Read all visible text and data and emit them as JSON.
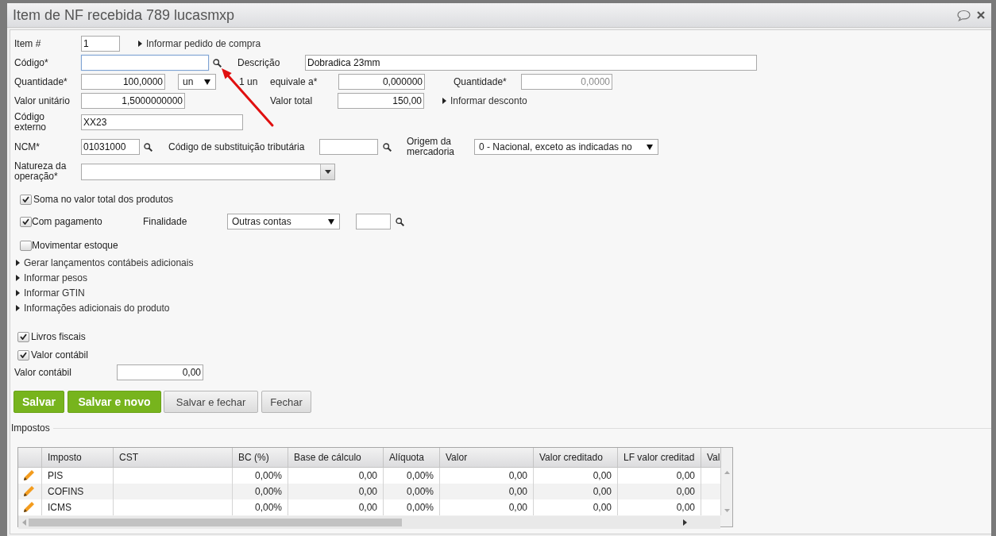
{
  "window": {
    "title": "Item de NF recebida 789 lucasmxp"
  },
  "form": {
    "item": {
      "label": "Item #",
      "value": "1"
    },
    "pedido_link": "Informar pedido de compra",
    "codigo": {
      "label": "Código*",
      "focused": true
    },
    "descricao": {
      "label": "Descrição",
      "value": "Dobradica 23mm"
    },
    "quantidade": {
      "label": "Quantidade*",
      "value": "100,0000"
    },
    "unidade": {
      "value": "un"
    },
    "conversao": "1 un",
    "equivale": {
      "label": "equivale a*",
      "value": "0,000000"
    },
    "quantidade_2": {
      "label": "Quantidade*",
      "value": "0,0000",
      "disabled": true
    },
    "valor_unitario": {
      "label": "Valor unitário",
      "value": "1,5000000000"
    },
    "valor_total": {
      "label": "Valor total",
      "value": "150,00"
    },
    "desconto_link": "Informar desconto",
    "codigo_externo": {
      "label": "Código externo",
      "value": "XX23"
    },
    "ncm": {
      "label": "NCM*",
      "value": "01031000"
    },
    "substituicao": {
      "label": "Código de substituição tributária"
    },
    "origem": {
      "label": "Origem da mercadoria",
      "value": "0 - Nacional, exceto as indicadas no"
    },
    "natureza": {
      "label": "Natureza da operação*"
    },
    "soma": {
      "label": "Soma no valor total dos produtos",
      "checked": true
    },
    "com_pagamento": {
      "label": "Com pagamento",
      "checked": true
    },
    "finalidade": {
      "label": "Finalidade",
      "value": "Outras contas"
    },
    "movimentar": {
      "label": "Movimentar estoque",
      "checked": false
    },
    "expanders": [
      "Gerar lançamentos contábeis adicionais",
      "Informar pesos",
      "Informar GTIN",
      "Informações adicionais do produto"
    ],
    "livros_fiscais": {
      "label": "Livros fiscais",
      "checked": true
    },
    "valor_contabil_check": {
      "label": "Valor contábil",
      "checked": true
    },
    "valor_contabil": {
      "label": "Valor contábil",
      "value": "0,00"
    }
  },
  "buttons": [
    {
      "label": "Salvar",
      "kind": "primary"
    },
    {
      "label": "Salvar e novo",
      "kind": "primary"
    },
    {
      "label": "Salvar e fechar",
      "kind": "secondary"
    },
    {
      "label": "Fechar",
      "kind": "secondary"
    }
  ],
  "impostos": {
    "title": "Impostos",
    "columns": [
      "Imposto",
      "CST",
      "BC (%)",
      "Base de cálculo",
      "Alíquota",
      "Valor",
      "Valor creditado",
      "LF valor creditad",
      "Val"
    ],
    "rows": [
      {
        "cells": [
          "PIS",
          null,
          "0,00%",
          "0,00",
          "0,00%",
          "0,00",
          "0,00",
          "0,00",
          null
        ]
      },
      {
        "cells": [
          "COFINS",
          null,
          "0,00%",
          "0,00",
          "0,00%",
          "0,00",
          "0,00",
          "0,00",
          null
        ]
      },
      {
        "cells": [
          "ICMS",
          null,
          "0,00%",
          "0,00",
          "0,00%",
          "0,00",
          "0,00",
          "0,00",
          null
        ]
      }
    ]
  }
}
